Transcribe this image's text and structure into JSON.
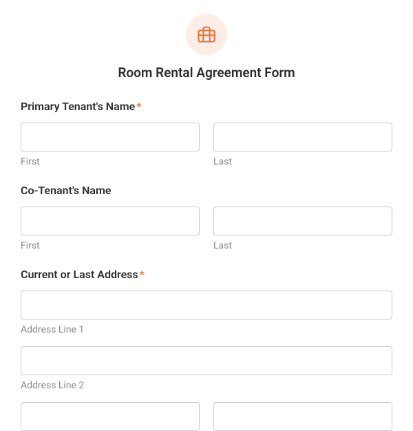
{
  "title": "Room Rental Agreement Form",
  "icon": "briefcase-icon",
  "fields": {
    "primary_tenant": {
      "label": "Primary Tenant's Name",
      "required": "*",
      "first_sublabel": "First",
      "last_sublabel": "Last"
    },
    "co_tenant": {
      "label": "Co-Tenant's Name",
      "first_sublabel": "First",
      "last_sublabel": "Last"
    },
    "address": {
      "label": "Current or Last Address",
      "required": "*",
      "line1_sublabel": "Address Line 1",
      "line2_sublabel": "Address Line 2"
    }
  }
}
